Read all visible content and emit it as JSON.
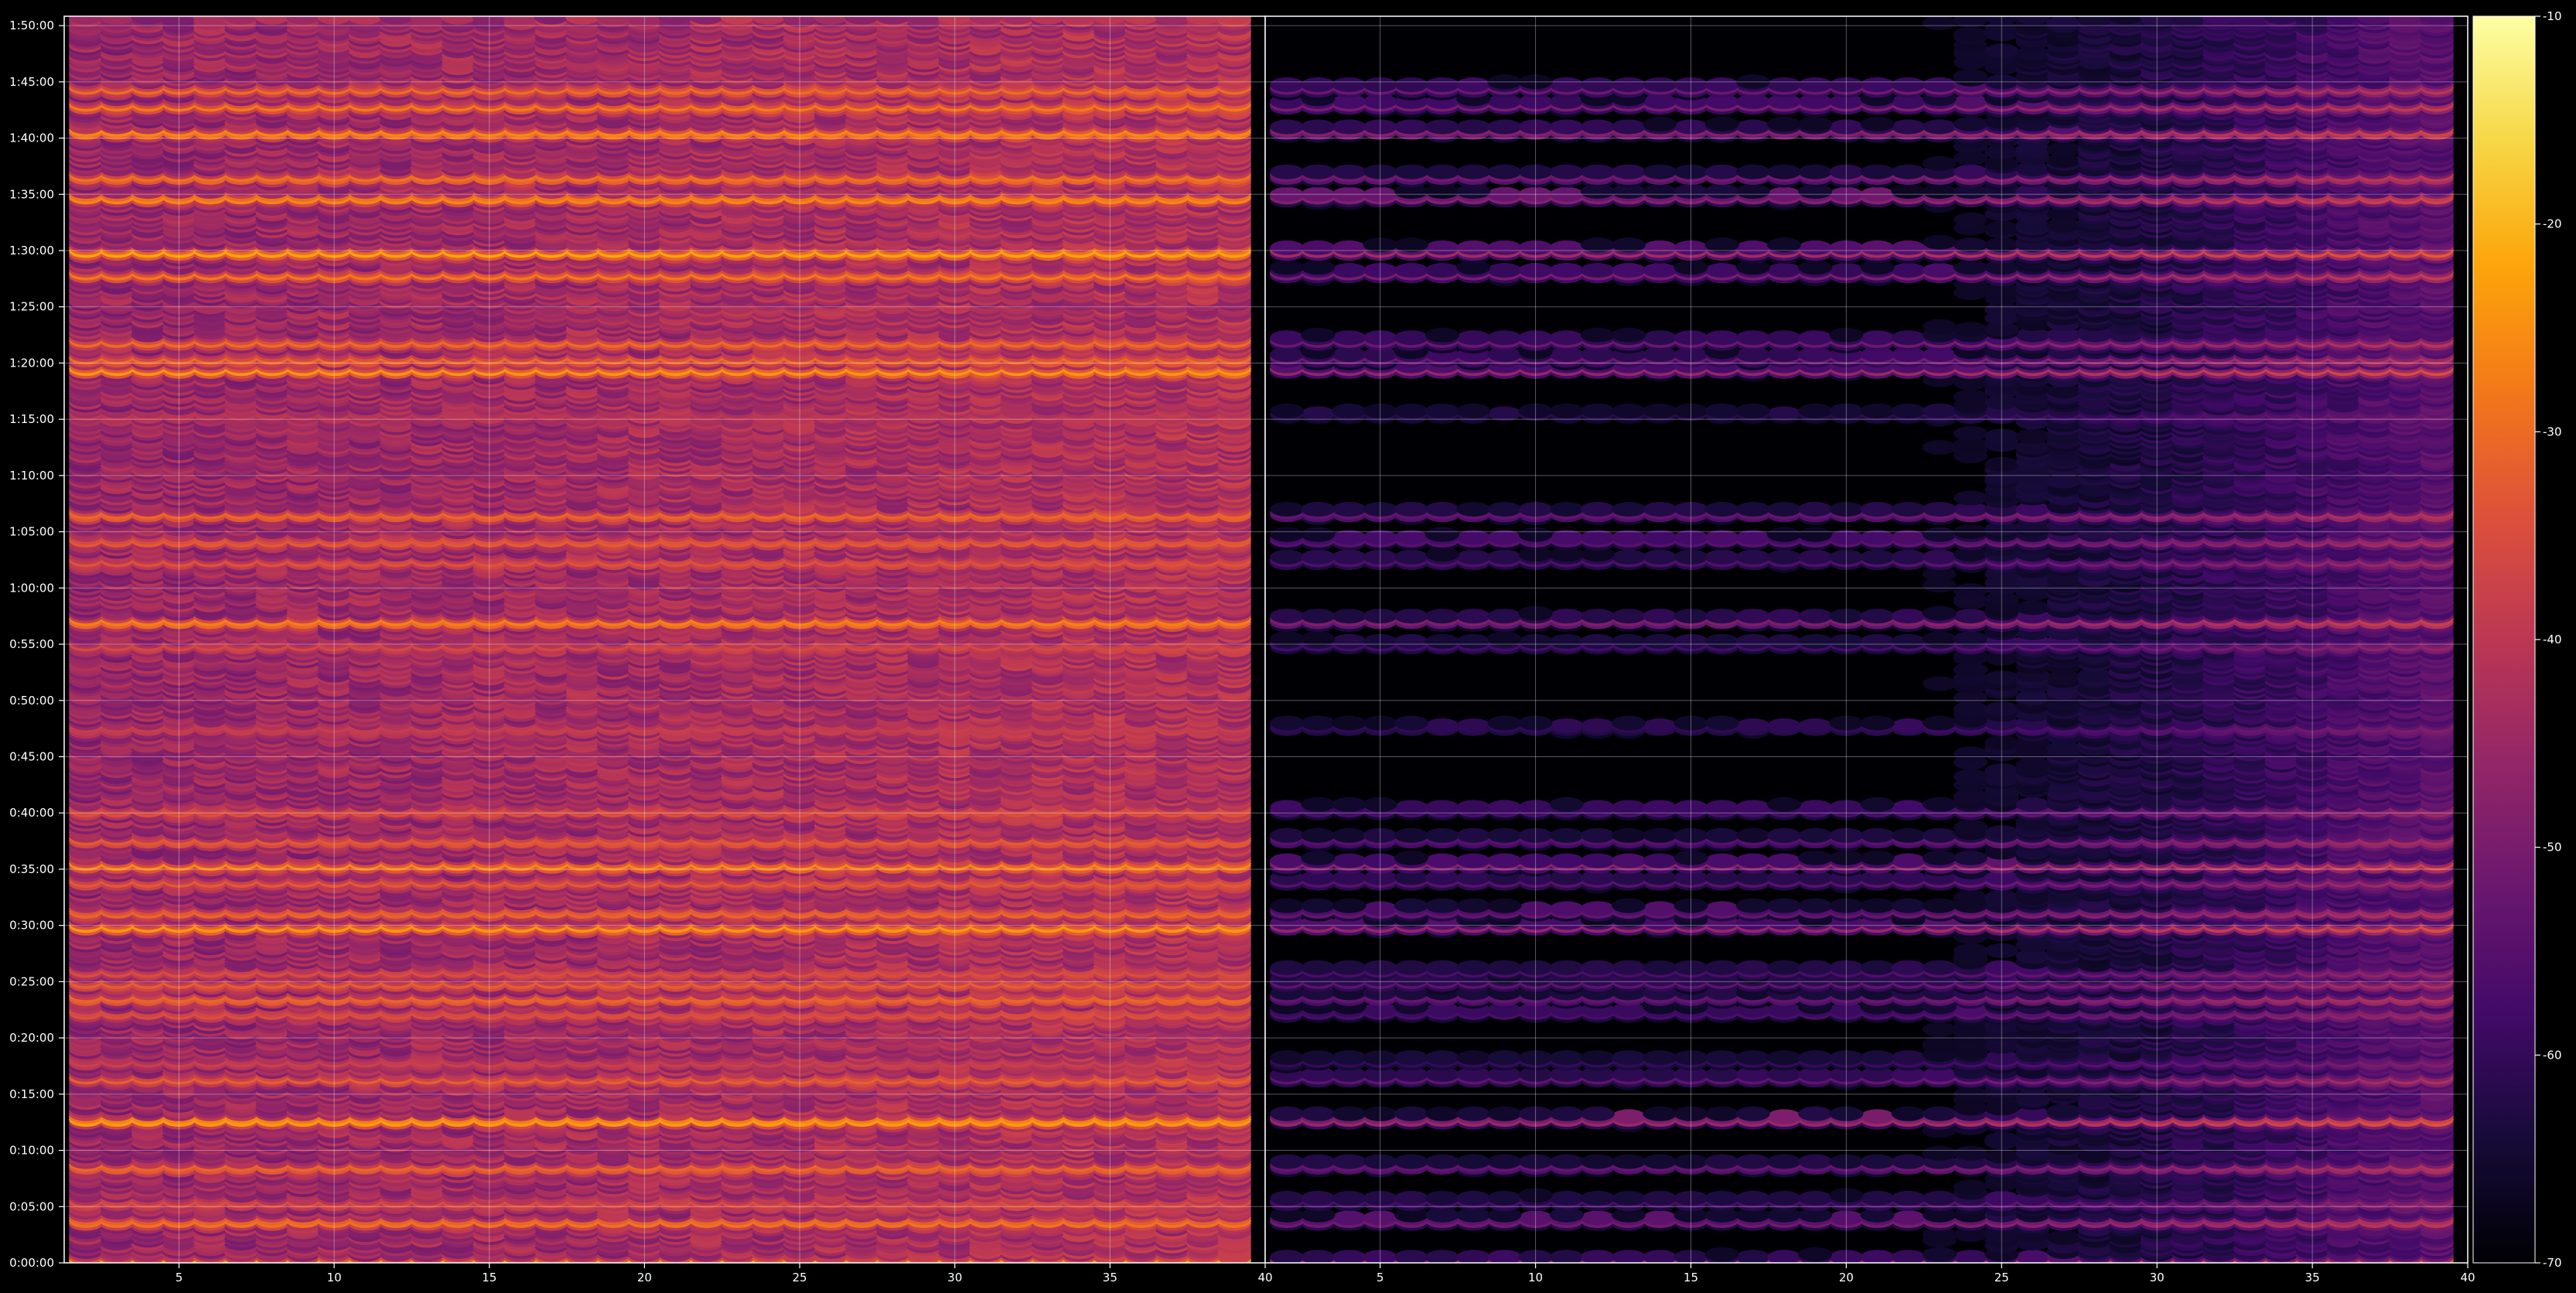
{
  "chart_data": {
    "type": "heatmap",
    "colormap": "inferno",
    "background": "#000000",
    "title": "",
    "xlabel": "",
    "ylabel": "",
    "grid": true,
    "grid_color": "#ffffff",
    "panels": [
      {
        "name": "",
        "xlim": [
          1.3,
          40
        ],
        "x_ticks": [
          "5",
          "10",
          "15",
          "20",
          "25",
          "30",
          "35",
          "40"
        ],
        "x_tick_values": [
          5,
          10,
          15,
          20,
          25,
          30,
          35,
          40
        ],
        "strength": "high"
      },
      {
        "name": "",
        "xlim": [
          1.3,
          40
        ],
        "x_ticks": [
          "5",
          "10",
          "15",
          "20",
          "25",
          "30",
          "35",
          "40"
        ],
        "x_tick_values": [
          5,
          10,
          15,
          20,
          25,
          30,
          35,
          40
        ],
        "strength": "low"
      }
    ],
    "ylim_seconds": [
      0,
      6650
    ],
    "y_ticks": [
      "0:00:00",
      "0:05:00",
      "0:10:00",
      "0:15:00",
      "0:20:00",
      "0:25:00",
      "0:30:00",
      "0:35:00",
      "0:40:00",
      "0:45:00",
      "0:50:00",
      "0:55:00",
      "1:00:00",
      "1:05:00",
      "1:10:00",
      "1:15:00",
      "1:20:00",
      "1:25:00",
      "1:30:00",
      "1:35:00",
      "1:40:00",
      "1:45:00",
      "1:50:00"
    ],
    "y_tick_values": [
      0,
      300,
      600,
      900,
      1200,
      1500,
      1800,
      2100,
      2400,
      2700,
      3000,
      3300,
      3600,
      3900,
      4200,
      4500,
      4800,
      5100,
      5400,
      5700,
      6000,
      6300,
      6600
    ],
    "colorbar": {
      "range": [
        -70,
        -10
      ],
      "ticks": [
        "-10",
        "-20",
        "-30",
        "-40",
        "-50",
        "-60",
        "-70"
      ],
      "tick_values": [
        -10,
        -20,
        -30,
        -40,
        -50,
        -60,
        -70
      ]
    },
    "bright_bands_seconds": [
      {
        "t": 10,
        "level": -22
      },
      {
        "t": 230,
        "level": -28
      },
      {
        "t": 330,
        "level": -35
      },
      {
        "t": 520,
        "level": -30
      },
      {
        "t": 770,
        "level": -22
      },
      {
        "t": 990,
        "level": -32
      },
      {
        "t": 1080,
        "level": -38
      },
      {
        "t": 1340,
        "level": -34
      },
      {
        "t": 1420,
        "level": -30
      },
      {
        "t": 1500,
        "level": -32
      },
      {
        "t": 1560,
        "level": -35
      },
      {
        "t": 1800,
        "level": -24
      },
      {
        "t": 1880,
        "level": -30
      },
      {
        "t": 2040,
        "level": -33
      },
      {
        "t": 2130,
        "level": -26
      },
      {
        "t": 2260,
        "level": -32
      },
      {
        "t": 2420,
        "level": -34
      },
      {
        "t": 2860,
        "level": -38
      },
      {
        "t": 3300,
        "level": -36
      },
      {
        "t": 3430,
        "level": -26
      },
      {
        "t": 3750,
        "level": -34
      },
      {
        "t": 3860,
        "level": -32
      },
      {
        "t": 4000,
        "level": -30
      },
      {
        "t": 4530,
        "level": -40
      },
      {
        "t": 4770,
        "level": -24
      },
      {
        "t": 4830,
        "level": -30
      },
      {
        "t": 4920,
        "level": -30
      },
      {
        "t": 5280,
        "level": -28
      },
      {
        "t": 5400,
        "level": -22
      },
      {
        "t": 5690,
        "level": -25
      },
      {
        "t": 5800,
        "level": -28
      },
      {
        "t": 6040,
        "level": -25
      },
      {
        "t": 6180,
        "level": -28
      },
      {
        "t": 6270,
        "level": -30
      }
    ]
  }
}
